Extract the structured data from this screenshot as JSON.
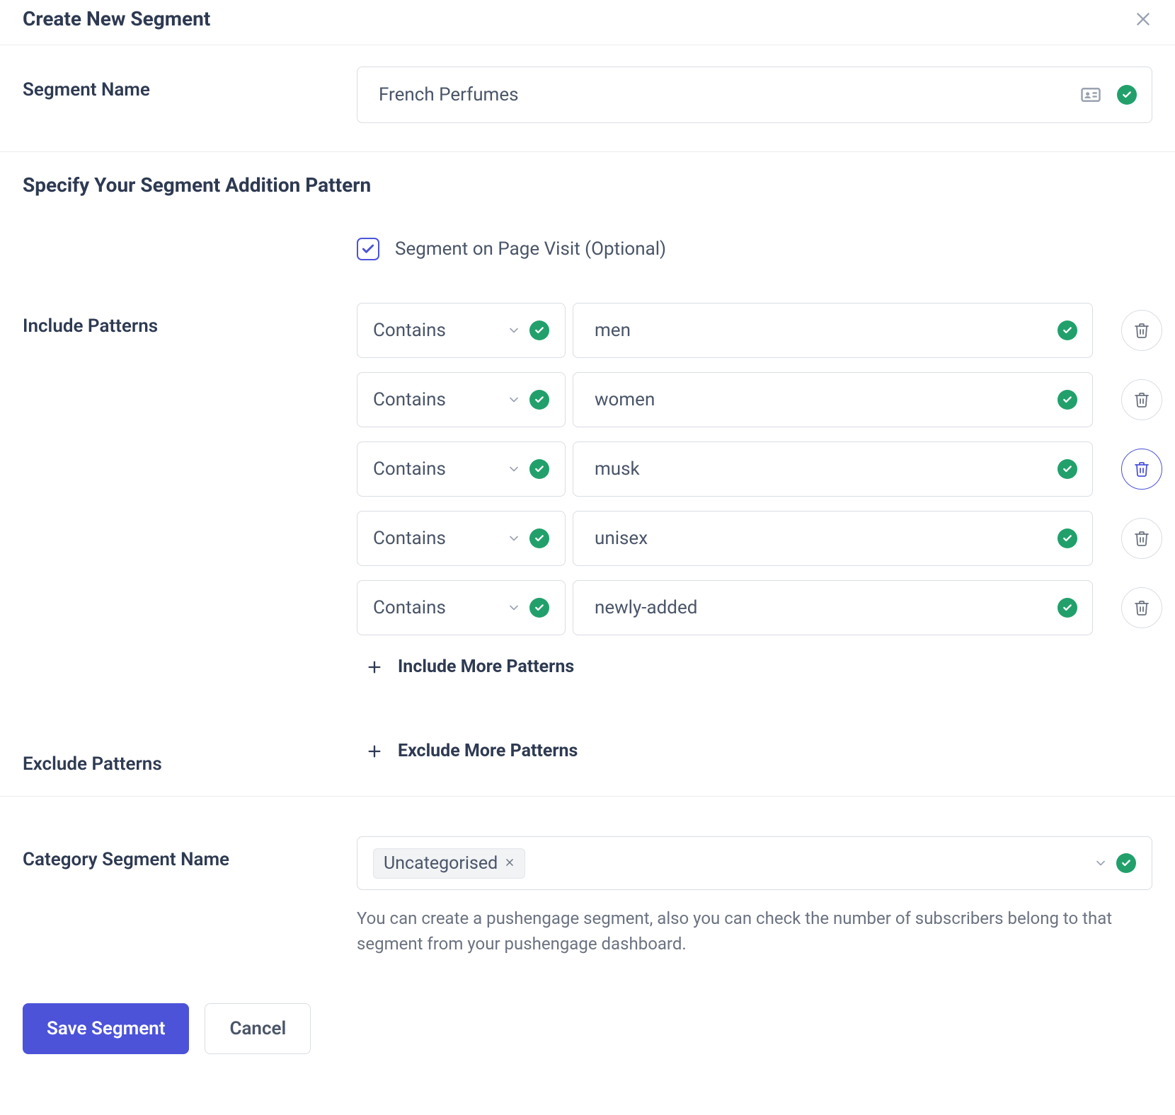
{
  "header": {
    "title": "Create New Segment"
  },
  "segment_name": {
    "label": "Segment Name",
    "value": "French Perfumes"
  },
  "addition_pattern": {
    "title": "Specify Your Segment Addition Pattern",
    "page_visit_label": "Segment on Page Visit (Optional)",
    "page_visit_checked": true
  },
  "include": {
    "label": "Include Patterns",
    "rows": [
      {
        "operator": "Contains",
        "value": "men",
        "delete_active": false
      },
      {
        "operator": "Contains",
        "value": "women",
        "delete_active": false
      },
      {
        "operator": "Contains",
        "value": "musk",
        "delete_active": true
      },
      {
        "operator": "Contains",
        "value": "unisex",
        "delete_active": false
      },
      {
        "operator": "Contains",
        "value": "newly-added",
        "delete_active": false
      }
    ],
    "add_more": "Include More Patterns"
  },
  "exclude": {
    "label": "Exclude Patterns",
    "add_more": "Exclude More Patterns"
  },
  "category": {
    "label": "Category Segment Name",
    "tags": [
      "Uncategorised"
    ],
    "help": "You can create a pushengage segment, also you can check the number of subscribers belong to that segment from your pushengage dashboard."
  },
  "footer": {
    "save": "Save Segment",
    "cancel": "Cancel"
  }
}
